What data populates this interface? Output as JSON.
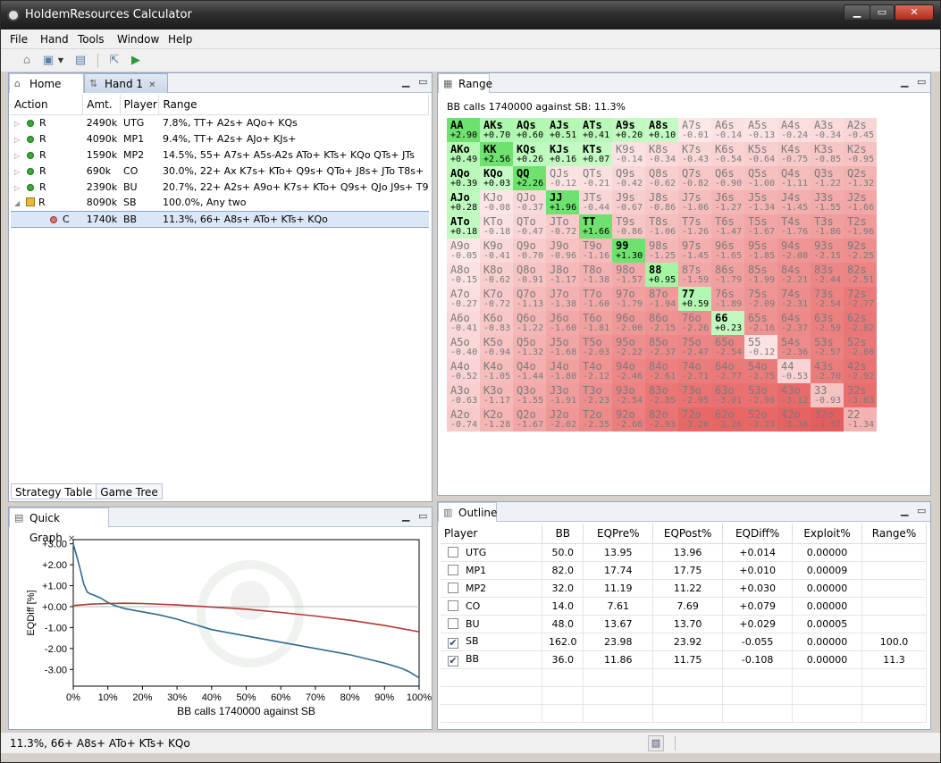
{
  "window": {
    "title": "HoldemResources Calculator",
    "min": "▁",
    "max": "▭",
    "close": "✕"
  },
  "menu": [
    "File",
    "Hand",
    "Tools",
    "Window",
    "Help"
  ],
  "tabs_left": [
    {
      "label": "Home",
      "icon": "home-icon"
    },
    {
      "label": "Hand 1",
      "icon": "hand-icon"
    }
  ],
  "strategy": {
    "headers": [
      "Action",
      "Amt.",
      "Player",
      "Range"
    ],
    "rows": [
      {
        "action": "R",
        "amt": "2490k",
        "player": "UTG",
        "range": "7.8%, TT+ A2s+ AQo+ KQs"
      },
      {
        "action": "R",
        "amt": "4090k",
        "player": "MP1",
        "range": "9.4%, TT+ A2s+ AJo+ KJs+"
      },
      {
        "action": "R",
        "amt": "1590k",
        "player": "MP2",
        "range": "14.5%, 55+ A7s+ A5s-A2s ATo+ KTs+ KQo QTs+ JTs"
      },
      {
        "action": "R",
        "amt": "690k",
        "player": "CO",
        "range": "30.0%, 22+ Ax K7s+ KTo+ Q9s+ QTo+ J8s+ JTo T8s+"
      },
      {
        "action": "R",
        "amt": "2390k",
        "player": "BU",
        "range": "20.7%, 22+ A2s+ A9o+ K7s+ KTo+ Q9s+ QJo J9s+ T9"
      },
      {
        "action": "R",
        "amt": "8090k",
        "player": "SB",
        "range": "100.0%, Any two"
      },
      {
        "action": "C",
        "amt": "1740k",
        "player": "BB",
        "range": "11.3%, 66+ A8s+ ATo+ KTs+ KQo"
      }
    ],
    "subtabs": [
      "Strategy Table",
      "Game Tree"
    ]
  },
  "range_panel": {
    "tab": "Range",
    "header": "BB calls 1740000 against SB: 11.3%",
    "grid": [
      [
        [
          "AA",
          "+2.90"
        ],
        [
          "AKs",
          "+0.70"
        ],
        [
          "AQs",
          "+0.60"
        ],
        [
          "AJs",
          "+0.51"
        ],
        [
          "ATs",
          "+0.41"
        ],
        [
          "A9s",
          "+0.20"
        ],
        [
          "A8s",
          "+0.10"
        ],
        [
          "A7s",
          "-0.01"
        ],
        [
          "A6s",
          "-0.14"
        ],
        [
          "A5s",
          "-0.13"
        ],
        [
          "A4s",
          "-0.24"
        ],
        [
          "A3s",
          "-0.34"
        ],
        [
          "A2s",
          "-0.45"
        ]
      ],
      [
        [
          "AKo",
          "+0.49"
        ],
        [
          "KK",
          "+2.56"
        ],
        [
          "KQs",
          "+0.26"
        ],
        [
          "KJs",
          "+0.16"
        ],
        [
          "KTs",
          "+0.07"
        ],
        [
          "K9s",
          "-0.14"
        ],
        [
          "K8s",
          "-0.34"
        ],
        [
          "K7s",
          "-0.43"
        ],
        [
          "K6s",
          "-0.54"
        ],
        [
          "K5s",
          "-0.64"
        ],
        [
          "K4s",
          "-0.75"
        ],
        [
          "K3s",
          "-0.85"
        ],
        [
          "K2s",
          "-0.95"
        ]
      ],
      [
        [
          "AQo",
          "+0.39"
        ],
        [
          "KQo",
          "+0.03"
        ],
        [
          "QQ",
          "+2.26"
        ],
        [
          "QJs",
          "-0.12"
        ],
        [
          "QTs",
          "-0.21"
        ],
        [
          "Q9s",
          "-0.42"
        ],
        [
          "Q8s",
          "-0.62"
        ],
        [
          "Q7s",
          "-0.82"
        ],
        [
          "Q6s",
          "-0.90"
        ],
        [
          "Q5s",
          "-1.00"
        ],
        [
          "Q4s",
          "-1.11"
        ],
        [
          "Q3s",
          "-1.22"
        ],
        [
          "Q2s",
          "-1.32"
        ]
      ],
      [
        [
          "AJo",
          "+0.28"
        ],
        [
          "KJo",
          "-0.08"
        ],
        [
          "QJo",
          "-0.37"
        ],
        [
          "JJ",
          "+1.96"
        ],
        [
          "JTs",
          "-0.44"
        ],
        [
          "J9s",
          "-0.67"
        ],
        [
          "J8s",
          "-0.86"
        ],
        [
          "J7s",
          "-1.06"
        ],
        [
          "J6s",
          "-1.27"
        ],
        [
          "J5s",
          "-1.34"
        ],
        [
          "J4s",
          "-1.45"
        ],
        [
          "J3s",
          "-1.55"
        ],
        [
          "J2s",
          "-1.66"
        ]
      ],
      [
        [
          "ATo",
          "+0.18"
        ],
        [
          "KTo",
          "-0.18"
        ],
        [
          "QTo",
          "-0.47"
        ],
        [
          "JTo",
          "-0.72"
        ],
        [
          "TT",
          "+1.66"
        ],
        [
          "T9s",
          "-0.86"
        ],
        [
          "T8s",
          "-1.06"
        ],
        [
          "T7s",
          "-1.26"
        ],
        [
          "T6s",
          "-1.47"
        ],
        [
          "T5s",
          "-1.67"
        ],
        [
          "T4s",
          "-1.76"
        ],
        [
          "T3s",
          "-1.86"
        ],
        [
          "T2s",
          "-1.96"
        ]
      ],
      [
        [
          "A9o",
          "-0.05"
        ],
        [
          "K9o",
          "-0.41"
        ],
        [
          "Q9o",
          "-0.70"
        ],
        [
          "J9o",
          "-0.96"
        ],
        [
          "T9o",
          "-1.16"
        ],
        [
          "99",
          "+1.30"
        ],
        [
          "98s",
          "-1.25"
        ],
        [
          "97s",
          "-1.45"
        ],
        [
          "96s",
          "-1.65"
        ],
        [
          "95s",
          "-1.85"
        ],
        [
          "94s",
          "-2.08"
        ],
        [
          "93s",
          "-2.15"
        ],
        [
          "92s",
          "-2.25"
        ]
      ],
      [
        [
          "A8o",
          "-0.15"
        ],
        [
          "K8o",
          "-0.62"
        ],
        [
          "Q8o",
          "-0.91"
        ],
        [
          "J8o",
          "-1.17"
        ],
        [
          "T8o",
          "-1.38"
        ],
        [
          "98o",
          "-1.57"
        ],
        [
          "88",
          "+0.95"
        ],
        [
          "87s",
          "-1.59"
        ],
        [
          "86s",
          "-1.79"
        ],
        [
          "85s",
          "-1.99"
        ],
        [
          "84s",
          "-2.21"
        ],
        [
          "83s",
          "-2.44"
        ],
        [
          "82s",
          "-2.51"
        ]
      ],
      [
        [
          "A7o",
          "-0.27"
        ],
        [
          "K7o",
          "-0.72"
        ],
        [
          "Q7o",
          "-1.13"
        ],
        [
          "J7o",
          "-1.38"
        ],
        [
          "T7o",
          "-1.60"
        ],
        [
          "97o",
          "-1.79"
        ],
        [
          "87o",
          "-1.94"
        ],
        [
          "77",
          "+0.59"
        ],
        [
          "76s",
          "-1.89"
        ],
        [
          "75s",
          "-2.09"
        ],
        [
          "74s",
          "-2.31"
        ],
        [
          "73s",
          "-2.54"
        ],
        [
          "72s",
          "-2.77"
        ]
      ],
      [
        [
          "A6o",
          "-0.41"
        ],
        [
          "K6o",
          "-0.83"
        ],
        [
          "Q6o",
          "-1.22"
        ],
        [
          "J6o",
          "-1.60"
        ],
        [
          "T6o",
          "-1.81"
        ],
        [
          "96o",
          "-2.00"
        ],
        [
          "86o",
          "-2.15"
        ],
        [
          "76o",
          "-2.26"
        ],
        [
          "66",
          "+0.23"
        ],
        [
          "65s",
          "-2.16"
        ],
        [
          "64s",
          "-2.37"
        ],
        [
          "63s",
          "-2.59"
        ],
        [
          "62s",
          "-2.82"
        ]
      ],
      [
        [
          "A5o",
          "-0.40"
        ],
        [
          "K5o",
          "-0.94"
        ],
        [
          "Q5o",
          "-1.32"
        ],
        [
          "J5o",
          "-1.68"
        ],
        [
          "T5o",
          "-2.03"
        ],
        [
          "95o",
          "-2.22"
        ],
        [
          "85o",
          "-2.37"
        ],
        [
          "75o",
          "-2.47"
        ],
        [
          "65o",
          "-2.54"
        ],
        [
          "55",
          "-0.12"
        ],
        [
          "54s",
          "-2.36"
        ],
        [
          "53s",
          "-2.57"
        ],
        [
          "52s",
          "-2.80"
        ]
      ],
      [
        [
          "A4o",
          "-0.52"
        ],
        [
          "K4o",
          "-1.05"
        ],
        [
          "Q4o",
          "-1.44"
        ],
        [
          "J4o",
          "-1.80"
        ],
        [
          "T4o",
          "-2.12"
        ],
        [
          "94o",
          "-2.46"
        ],
        [
          "84o",
          "-2.61"
        ],
        [
          "74o",
          "-2.71"
        ],
        [
          "64o",
          "-2.77"
        ],
        [
          "54o",
          "-2.75"
        ],
        [
          "44",
          "-0.53"
        ],
        [
          "43s",
          "-2.70"
        ],
        [
          "42s",
          "-2.92"
        ]
      ],
      [
        [
          "A3o",
          "-0.63"
        ],
        [
          "K3o",
          "-1.17"
        ],
        [
          "Q3o",
          "-1.55"
        ],
        [
          "J3o",
          "-1.91"
        ],
        [
          "T3o",
          "-2.23"
        ],
        [
          "93o",
          "-2.54"
        ],
        [
          "83o",
          "-2.85"
        ],
        [
          "73o",
          "-2.95"
        ],
        [
          "63o",
          "-3.01"
        ],
        [
          "53o",
          "-2.98"
        ],
        [
          "43o",
          "-3.12"
        ],
        [
          "33",
          "-0.93"
        ],
        [
          "32s",
          "-3.03"
        ]
      ],
      [
        [
          "A2o",
          "-0.74"
        ],
        [
          "K2o",
          "-1.28"
        ],
        [
          "Q2o",
          "-1.67"
        ],
        [
          "J2o",
          "-2.02"
        ],
        [
          "T2o",
          "-2.35"
        ],
        [
          "92o",
          "-2.66"
        ],
        [
          "82o",
          "-2.93"
        ],
        [
          "72o",
          "-3.20"
        ],
        [
          "62o",
          "-3.26"
        ],
        [
          "52o",
          "-3.23"
        ],
        [
          "42o",
          "-3.36"
        ],
        [
          "32o",
          "-3.47"
        ],
        [
          "22",
          "-1.34"
        ]
      ]
    ],
    "selected": [
      "AA",
      "KK",
      "QQ",
      "JJ",
      "TT",
      "99",
      "88",
      "77",
      "66",
      "AKs",
      "AQs",
      "AJs",
      "ATs",
      "A9s",
      "A8s",
      "KQs",
      "KJs",
      "KTs",
      "AKo",
      "AQo",
      "AJo",
      "ATo",
      "KQo"
    ]
  },
  "quick_graph": {
    "tab": "Quick Graph",
    "chart_data": {
      "type": "line",
      "xlabel": "BB calls 1740000 against SB",
      "ylabel": "EQDiff [%]",
      "x_ticks": [
        "0%",
        "10%",
        "20%",
        "30%",
        "40%",
        "50%",
        "60%",
        "70%",
        "80%",
        "90%",
        "100%"
      ],
      "y_ticks": [
        "+3.00",
        "+2.00",
        "+1.00",
        "+0.00",
        "-1.00",
        "-2.00",
        "-3.00"
      ],
      "xlim": [
        0,
        100
      ],
      "ylim": [
        -3.8,
        3.2
      ],
      "series": [
        {
          "color": "#2e6a93",
          "x": [
            0,
            1,
            2,
            3,
            4,
            5,
            6,
            8,
            10,
            12,
            15,
            20,
            25,
            30,
            35,
            40,
            45,
            50,
            55,
            60,
            65,
            70,
            75,
            80,
            85,
            90,
            95,
            97,
            99,
            100
          ],
          "y": [
            3.0,
            2.4,
            1.8,
            1.1,
            0.7,
            0.6,
            0.55,
            0.4,
            0.2,
            0.05,
            -0.1,
            -0.25,
            -0.4,
            -0.6,
            -0.85,
            -1.1,
            -1.25,
            -1.4,
            -1.55,
            -1.7,
            -1.85,
            -2.0,
            -2.15,
            -2.3,
            -2.5,
            -2.7,
            -2.95,
            -3.1,
            -3.3,
            -3.4
          ]
        },
        {
          "color": "#b03a32",
          "x": [
            0,
            5,
            10,
            15,
            20,
            30,
            40,
            50,
            60,
            70,
            80,
            90,
            100
          ],
          "y": [
            0.05,
            0.12,
            0.15,
            0.16,
            0.15,
            0.08,
            -0.02,
            -0.12,
            -0.28,
            -0.45,
            -0.65,
            -0.9,
            -1.2
          ]
        }
      ]
    }
  },
  "outline": {
    "tab": "Outline",
    "headers": [
      "Player",
      "BB",
      "EQPre%",
      "EQPost%",
      "EQDiff%",
      "Exploit%",
      "Range%"
    ],
    "rows": [
      {
        "checked": false,
        "player": "UTG",
        "bb": "50.0",
        "eqpre": "13.95",
        "eqpost": "13.96",
        "eqdiff": "+0.014",
        "exploit": "0.00000",
        "range": ""
      },
      {
        "checked": false,
        "player": "MP1",
        "bb": "82.0",
        "eqpre": "17.74",
        "eqpost": "17.75",
        "eqdiff": "+0.010",
        "exploit": "0.00009",
        "range": ""
      },
      {
        "checked": false,
        "player": "MP2",
        "bb": "32.0",
        "eqpre": "11.19",
        "eqpost": "11.22",
        "eqdiff": "+0.030",
        "exploit": "0.00000",
        "range": ""
      },
      {
        "checked": false,
        "player": "CO",
        "bb": "14.0",
        "eqpre": "7.61",
        "eqpost": "7.69",
        "eqdiff": "+0.079",
        "exploit": "0.00000",
        "range": ""
      },
      {
        "checked": false,
        "player": "BU",
        "bb": "48.0",
        "eqpre": "13.67",
        "eqpost": "13.70",
        "eqdiff": "+0.029",
        "exploit": "0.00005",
        "range": ""
      },
      {
        "checked": true,
        "player": "SB",
        "bb": "162.0",
        "eqpre": "23.98",
        "eqpost": "23.92",
        "eqdiff": "-0.055",
        "exploit": "0.00000",
        "range": "100.0"
      },
      {
        "checked": true,
        "player": "BB",
        "bb": "36.0",
        "eqpre": "11.86",
        "eqpost": "11.75",
        "eqdiff": "-0.108",
        "exploit": "0.00000",
        "range": "11.3"
      }
    ]
  },
  "status": {
    "text": "11.3%, 66+ A8s+ ATo+ KTs+ KQo"
  }
}
